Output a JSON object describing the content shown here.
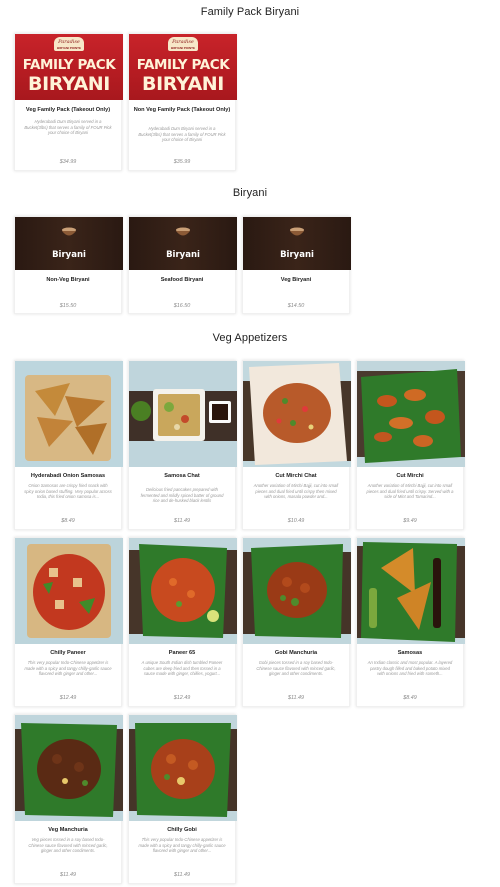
{
  "sections": {
    "family": "Family Pack Biryani",
    "biryani": "Biryani",
    "veg_appetizers": "Veg Appetizers"
  },
  "banners": {
    "family_logo_title": "Paradise",
    "family_logo_sub": "BIRYANI POINTE",
    "family_line1": "FAMILY PACK",
    "family_line2": "BIRYANI",
    "biryani_label": "Biryani"
  },
  "family": [
    {
      "name": "Veg Family Pack (Takeout Only)",
      "desc": "Hyderabadi Dum Biryani served in a Bucket(3lbs) that serves a family of FOUR Pick your choice of Biryani",
      "price": "$34.99"
    },
    {
      "name": "Non Veg Family Pack (Takeout Only)",
      "desc": "Hyderabadi Dum Biryani served in a Bucket(3lbs) that serves a family of FOUR Pick your choice of Biryani",
      "price": "$35.99"
    }
  ],
  "biryani": [
    {
      "name": "Non-Veg Biryani",
      "price": "$15.50"
    },
    {
      "name": "Seafood Biryani",
      "price": "$16.50"
    },
    {
      "name": "Veg Biryani",
      "price": "$14.50"
    }
  ],
  "appetizers": [
    {
      "name": "Hyderabadi Onion Samosas",
      "desc": "Onion Samosas are crispy fried snack with spicy onion based stuffing. Very popular across India, this fried onion samosa is...",
      "price": "$8.49"
    },
    {
      "name": "Samosa Chat",
      "desc": "Delicious fried pancakes prepared with fermented and mildly spiced batter of ground rice and de-husked black lentils",
      "price": "$11.49"
    },
    {
      "name": "Cut Mirchi Chat",
      "desc": "Another variation of Mirchi Bajji, cut into small pieces and dual fried until crispy then mixed with onions, masala powder and...",
      "price": "$10.49"
    },
    {
      "name": "Cut Mirchi",
      "desc": "Another variation of Mirchi Bajji, cut into small pieces and dual fried until crispy. Served with a side of Mint and Tamarind...",
      "price": "$9.49"
    },
    {
      "name": "Chilly Paneer",
      "desc": "This very popular Indo-Chinese appetizer is made with a spicy and tangy chilly-garlic sauce flavored with ginger and other...",
      "price": "$12.49"
    },
    {
      "name": "Paneer 65",
      "desc": "A unique South Indian dish tumbled Paneer cubes are deep fried and then tossed in a sauce made with ginger, chillies, yogurt...",
      "price": "$12.49"
    },
    {
      "name": "Gobi Manchuria",
      "desc": "Gobi pieces tossed in a soy based Indo-Chinese sauce flavored with minced garlic, ginger and other condiments.",
      "price": "$11.49"
    },
    {
      "name": "Samosas",
      "desc": "An Indian classic and most popular. A layered pastry dough filled and baked potato mixed with onions and fried with someth...",
      "price": "$8.49"
    },
    {
      "name": "Veg Manchuria",
      "desc": "Veg pieces tossed in a soy based Indo-Chinese sauce flavored with minced garlic, ginger and other condiments.",
      "price": "$11.49"
    },
    {
      "name": "Chilly Gobi",
      "desc": "This very popular Indo-Chinese appetizer is made with a spicy and tangy chilly-garlic sauce flavored with ginger and other...",
      "price": "$11.49"
    }
  ],
  "colors": {
    "family_banner": "#c8232a",
    "biryani_banner": "#2a1912",
    "leaf_green": "#2f7a2a",
    "fried_orange": "#c4561d"
  }
}
